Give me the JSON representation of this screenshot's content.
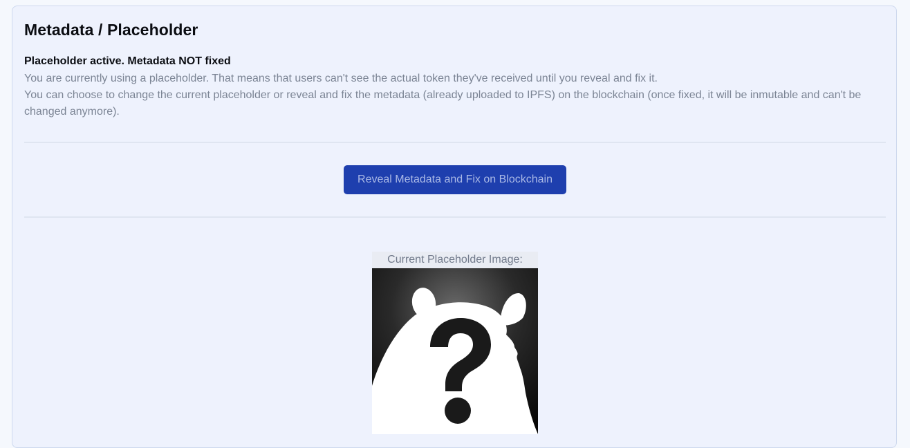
{
  "panel": {
    "title": "Metadata / Placeholder",
    "status_heading": "Placeholder active. Metadata NOT fixed",
    "description_line_1": "You are currently using a placeholder. That means that users can't see the actual token they've received until you reveal and fix it.",
    "description_line_2": "You can choose to change the current placeholder or reveal and fix the metadata (already uploaded to IPFS) on the blockchain (once fixed, it will be inmutable and can't be changed anymore)."
  },
  "actions": {
    "reveal_button_label": "Reveal Metadata and Fix on Blockchain"
  },
  "placeholder": {
    "caption": "Current Placeholder Image:",
    "image_icon": "mystery-silhouette-question-mark"
  },
  "colors": {
    "panel_background": "#eef2fd",
    "button_background": "#1e3fae",
    "button_text": "#aab9e6",
    "muted_text": "#7b8494"
  }
}
